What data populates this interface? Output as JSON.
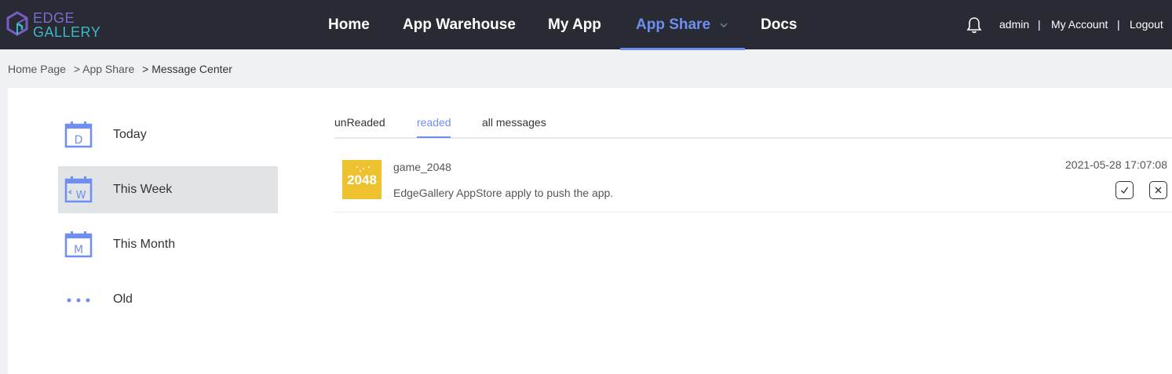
{
  "header": {
    "logo_line1": "EDGE",
    "logo_line2": "GALLERY",
    "nav": [
      {
        "label": "Home"
      },
      {
        "label": "App Warehouse"
      },
      {
        "label": "My App"
      },
      {
        "label": "App Share",
        "active": true
      },
      {
        "label": "Docs"
      }
    ],
    "user": {
      "username": "admin",
      "separator": "|",
      "my_account": "My Account",
      "logout": "Logout"
    },
    "icons": {
      "bell": "bell-icon",
      "chevron": "chevron-down-icon"
    }
  },
  "breadcrumb": [
    {
      "label": "Home Page"
    },
    {
      "label": "> App Share"
    },
    {
      "label": "> Message Center"
    }
  ],
  "sidebar": {
    "items": [
      {
        "label": "Today",
        "icon": "calendar-day-icon",
        "glyph": "D"
      },
      {
        "label": "This Week",
        "icon": "calendar-week-icon",
        "glyph": "W",
        "active": true
      },
      {
        "label": "This Month",
        "icon": "calendar-month-icon",
        "glyph": "M"
      },
      {
        "label": "Old",
        "icon": "more-dots-icon"
      }
    ]
  },
  "tabs": [
    {
      "label": "unReaded"
    },
    {
      "label": "readed",
      "active": true
    },
    {
      "label": "all messages"
    }
  ],
  "messages": [
    {
      "app_name": "game_2048",
      "thumbnail_text": "2048",
      "text": "EdgeGallery AppStore apply to push the app.",
      "time": "2021-05-28 17:07:08"
    }
  ],
  "colors": {
    "accent": "#6e8ef0",
    "header_bg": "#282b33",
    "thumb_bg": "#edc22e",
    "active_side_bg": "#e1e4e6"
  }
}
